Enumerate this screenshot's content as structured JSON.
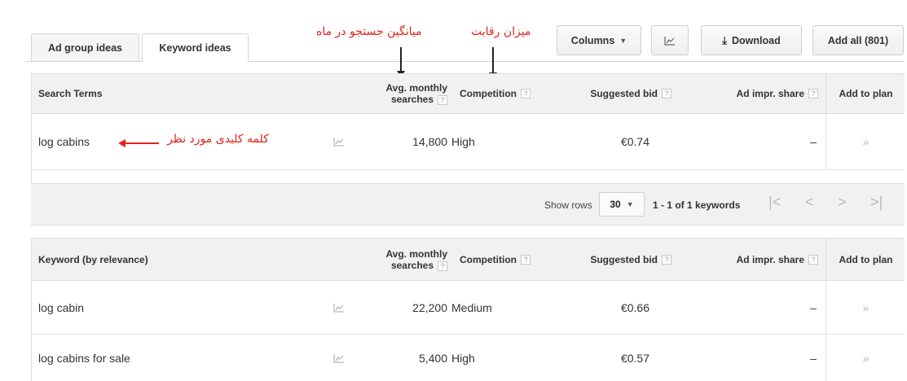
{
  "tabs": [
    {
      "label": "Ad group ideas",
      "active": false
    },
    {
      "label": "Keyword ideas",
      "active": true
    }
  ],
  "toolbar": {
    "columns_label": "Columns",
    "download_label": "Download",
    "add_all_label": "Add all (801)"
  },
  "annotations": {
    "avg_searches": "میانگین جستجو در ماه",
    "competition": "میزان رقابت",
    "keyword": "کلمه کلیدی مورد نظر"
  },
  "search_table": {
    "headers": {
      "term": "Search Terms",
      "avg_line1": "Avg. monthly",
      "avg_line2": "searches",
      "competition": "Competition",
      "bid": "Suggested bid",
      "impr": "Ad impr. share",
      "add": "Add to plan"
    },
    "rows": [
      {
        "term": "log cabins",
        "searches": "14,800",
        "competition": "High",
        "bid": "€0.74",
        "impr": "–",
        "add": "»"
      }
    ]
  },
  "pagination": {
    "show_rows_label": "Show rows",
    "rows_value": "30",
    "range_text": "1 - 1 of 1 keywords"
  },
  "keyword_table": {
    "headers": {
      "term": "Keyword (by relevance)",
      "avg_line1": "Avg. monthly",
      "avg_line2": "searches",
      "competition": "Competition",
      "bid": "Suggested bid",
      "impr": "Ad impr. share",
      "add": "Add to plan"
    },
    "rows": [
      {
        "term": "log cabin",
        "searches": "22,200",
        "competition": "Medium",
        "bid": "€0.66",
        "impr": "–",
        "add": "»"
      },
      {
        "term": "log cabins for sale",
        "searches": "5,400",
        "competition": "High",
        "bid": "€0.57",
        "impr": "–",
        "add": "»"
      }
    ]
  },
  "colors": {
    "annotation": "#e2231a",
    "header_bg": "#f1f1f1"
  }
}
